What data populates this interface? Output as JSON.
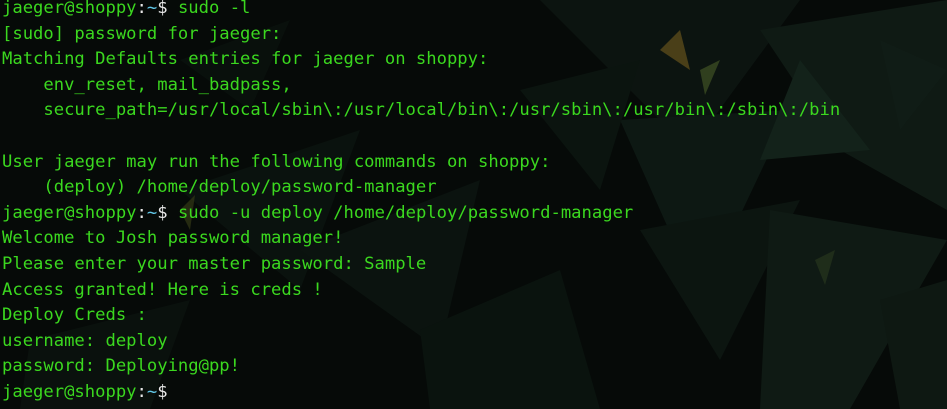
{
  "prompt": {
    "user_host": "jaeger@shoppy",
    "sep": ":",
    "path": "~",
    "dollar": "$"
  },
  "top_fragment": "/ / _",
  "lines": [
    {
      "type": "prompt",
      "command": " sudo -l"
    },
    {
      "type": "output",
      "text": "[sudo] password for jaeger:"
    },
    {
      "type": "output",
      "text": "Matching Defaults entries for jaeger on shoppy:"
    },
    {
      "type": "output",
      "text": "    env_reset, mail_badpass,"
    },
    {
      "type": "output",
      "text": "    secure_path=/usr/local/sbin\\:/usr/local/bin\\:/usr/sbin\\:/usr/bin\\:/sbin\\:/bin"
    },
    {
      "type": "output",
      "text": ""
    },
    {
      "type": "output",
      "text": "User jaeger may run the following commands on shoppy:"
    },
    {
      "type": "output",
      "text": "    (deploy) /home/deploy/password-manager"
    },
    {
      "type": "prompt",
      "command": " sudo -u deploy /home/deploy/password-manager"
    },
    {
      "type": "output",
      "text": "Welcome to Josh password manager!"
    },
    {
      "type": "output",
      "text": "Please enter your master password: Sample"
    },
    {
      "type": "output",
      "text": "Access granted! Here is creds !"
    },
    {
      "type": "output",
      "text": "Deploy Creds :"
    },
    {
      "type": "output",
      "text": "username: deploy"
    },
    {
      "type": "output",
      "text": "password: Deploying@pp!"
    },
    {
      "type": "prompt",
      "command": " "
    }
  ],
  "colors": {
    "background": "#060a08",
    "text_green": "#3bd81f",
    "prompt_white": "#e8e8e8",
    "tilde_cyan": "#62c8e8"
  }
}
